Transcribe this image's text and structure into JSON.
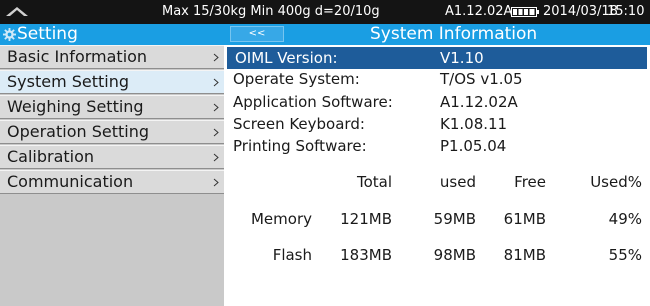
{
  "status_bar": {
    "scale_info": "Max 15/30kg  Min 400g  d=20/10g",
    "version": "A1.12.02A",
    "date": "2014/03/18",
    "time": "15:10"
  },
  "sidebar": {
    "title": "Setting",
    "items": [
      {
        "label": "Basic Information",
        "selected": false
      },
      {
        "label": "System Setting",
        "selected": true
      },
      {
        "label": "Weighing Setting",
        "selected": false
      },
      {
        "label": "Operation Setting",
        "selected": false
      },
      {
        "label": "Calibration",
        "selected": false
      },
      {
        "label": "Communication",
        "selected": false
      }
    ]
  },
  "main": {
    "back_label": "<<",
    "title": "System Information",
    "info_rows": [
      {
        "label": "OIML Version:",
        "value": "V1.10",
        "highlighted": true
      },
      {
        "label": "Operate System:",
        "value": "T/OS v1.05",
        "highlighted": false
      },
      {
        "label": "Application Software:",
        "value": "A1.12.02A",
        "highlighted": false
      },
      {
        "label": "Screen Keyboard:",
        "value": "K1.08.11",
        "highlighted": false
      },
      {
        "label": "Printing Software:",
        "value": "P1.05.04",
        "highlighted": false
      }
    ],
    "stats": {
      "columns": [
        "Total",
        "used",
        "Free",
        "Used%"
      ],
      "rows": [
        {
          "name": "Memory",
          "total": "121MB",
          "used": "59MB",
          "free": "61MB",
          "used_pct": "49%"
        },
        {
          "name": "Flash",
          "total": "183MB",
          "used": "98MB",
          "free": "81MB",
          "used_pct": "55%"
        }
      ]
    }
  },
  "colors": {
    "header_blue": "#1a9ee3",
    "highlight_row": "#1e5c9a",
    "sidebar_gray": "#c9c9c9",
    "selected_item": "#dcecf7",
    "status_bar": "#141414"
  },
  "icons": {
    "logo": "brand-logo-icon",
    "battery": "battery-icon",
    "gear": "gear-icon",
    "menu_arrow": "chevron-right-icon"
  }
}
